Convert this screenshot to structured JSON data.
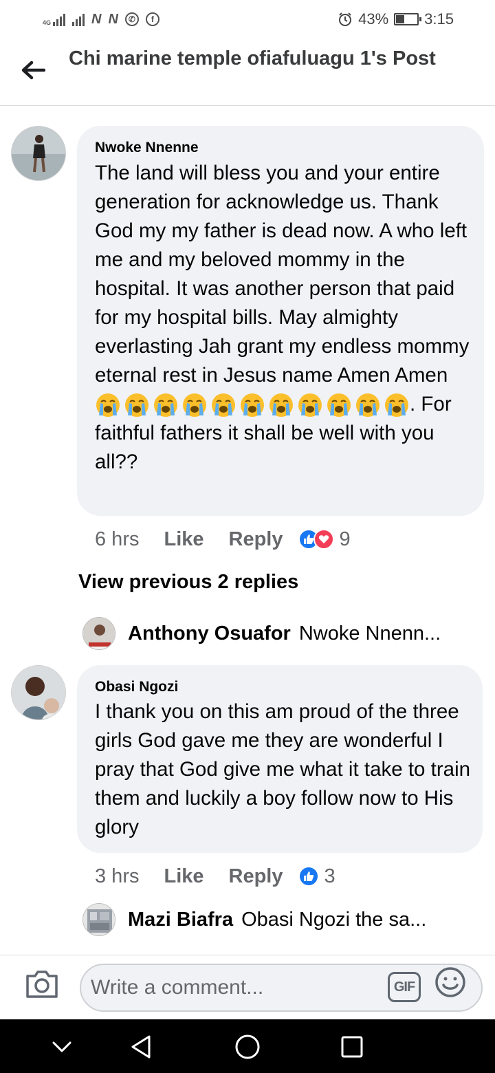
{
  "status_bar": {
    "network_label": "4G",
    "battery_percent": "43%",
    "battery_level": 0.43,
    "time": "3:15"
  },
  "header": {
    "title": "Chi marine temple ofiafuluagu 1's Post",
    "back_icon": "arrow-left-icon"
  },
  "comments": [
    {
      "author": "Nwoke Nnenne",
      "text_before_emoji": "The land will bless you and your entire generation for acknowledge us. Thank God my my father is dead now. A who left me and my beloved mommy in the hospital. It was another person that paid for my hospital bills. May almighty everlasting Jah grant my endless mommy eternal rest in Jesus name Amen Amen",
      "emoji": "loudly-crying-face",
      "emoji_count": 11,
      "text_after_emoji": ". For faithful fathers it shall be well with you all??",
      "time": "6 hrs",
      "like_label": "Like",
      "reply_label": "Reply",
      "reactions": [
        "like",
        "love"
      ],
      "reaction_count": "9"
    },
    {
      "author": "Obasi Ngozi",
      "text": "I thank you on this am proud of the three girls God gave me they are wonderful I pray that God give me what it take to train them and luckily a boy follow now to His glory",
      "time": "3 hrs",
      "like_label": "Like",
      "reply_label": "Reply",
      "reactions": [
        "like"
      ],
      "reaction_count": "3"
    }
  ],
  "view_previous": "View previous 2 replies",
  "replies": [
    {
      "name": "Anthony Osuafor",
      "preview": "Nwoke Nnenn..."
    },
    {
      "name": "Mazi Biafra",
      "preview": "Obasi Ngozi the sa..."
    }
  ],
  "composer": {
    "placeholder": "Write a comment...",
    "gif_label": "GIF",
    "camera_icon": "camera-icon",
    "emoji_icon": "smiley-icon"
  },
  "nav": {
    "icons": [
      "chevron-down-icon",
      "back-triangle-icon",
      "home-circle-icon",
      "recents-square-icon"
    ]
  },
  "colors": {
    "bubble": "#f0f2f5",
    "like_blue": "#1877f2",
    "love_red": "#f33e58",
    "secondary_text": "#65676b"
  }
}
